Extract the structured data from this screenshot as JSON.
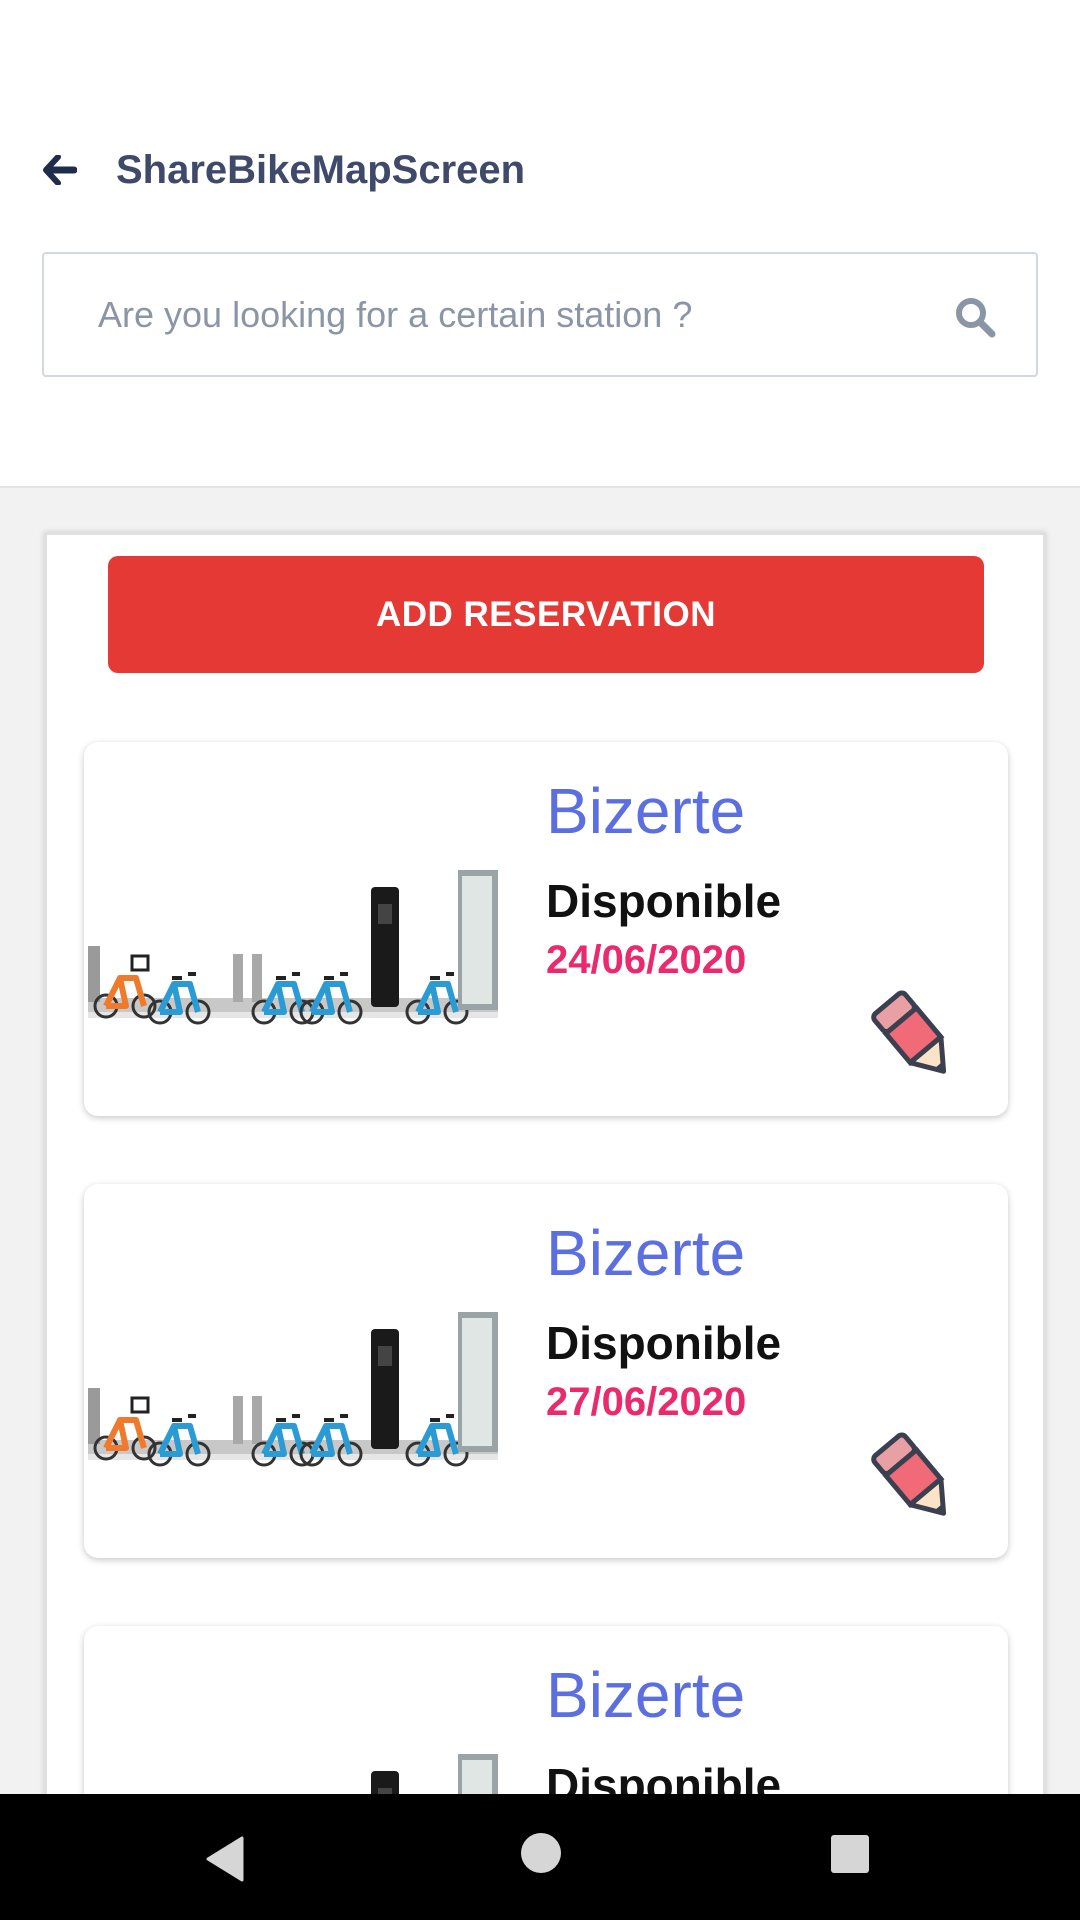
{
  "header": {
    "title": "ShareBikeMapScreen",
    "back_icon": "arrow-left-icon"
  },
  "search": {
    "placeholder": "Are you looking for a certain station ?",
    "value": "",
    "icon": "search-icon"
  },
  "actions": {
    "add_reservation_label": "ADD RESERVATION",
    "color": "#e53935"
  },
  "reservations": [
    {
      "city": "Bizerte",
      "status": "Disponible",
      "date": "24/06/2020",
      "image": "bike-station-photo",
      "edit_icon": "pencil-icon"
    },
    {
      "city": "Bizerte",
      "status": "Disponible",
      "date": "27/06/2020",
      "image": "bike-station-photo",
      "edit_icon": "pencil-icon"
    },
    {
      "city": "Bizerte",
      "status": "Disponible",
      "date": "",
      "image": "bike-station-photo",
      "edit_icon": "pencil-icon"
    }
  ],
  "colors": {
    "title": "#3f4a6b",
    "city": "#5c6fe0",
    "date": "#ea2a6c",
    "background": "#f2f2f2"
  },
  "system_nav": {
    "back_icon": "triangle-back-icon",
    "home_icon": "circle-home-icon",
    "recents_icon": "square-recents-icon"
  }
}
